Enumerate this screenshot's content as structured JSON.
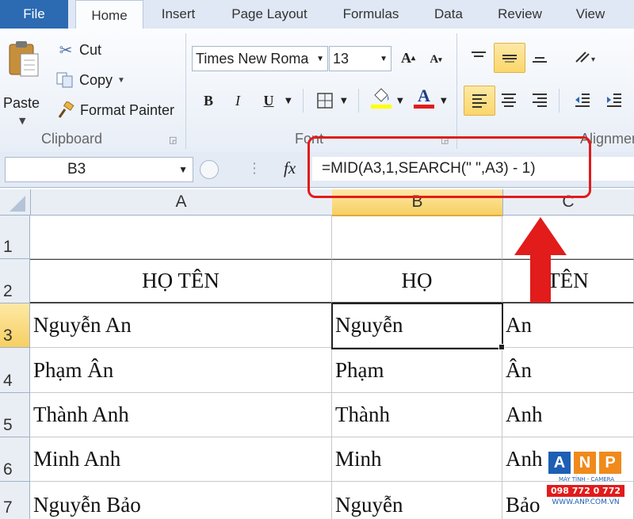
{
  "ribbon": {
    "tabs": [
      "File",
      "Home",
      "Insert",
      "Page Layout",
      "Formulas",
      "Data",
      "Review",
      "View"
    ],
    "clipboard": {
      "paste_label": "Paste",
      "cut_label": "Cut",
      "copy_label": "Copy",
      "format_painter_label": "Format Painter",
      "group_label": "Clipboard"
    },
    "font": {
      "font_name": "Times New Roma",
      "font_size": "13",
      "group_label": "Font"
    },
    "alignment": {
      "group_label": "Alignment"
    }
  },
  "formula_bar": {
    "name_box": "B3",
    "fx_label": "fx",
    "formula": "=MID(A3,1,SEARCH(\" \",A3) - 1)"
  },
  "grid": {
    "columns": [
      "A",
      "B",
      "C"
    ],
    "rows": [
      {
        "num": "1",
        "cells": [
          "",
          "",
          ""
        ]
      },
      {
        "num": "2",
        "cells": [
          "HỌ TÊN",
          "HỌ",
          "TÊN"
        ]
      },
      {
        "num": "3",
        "cells": [
          "Nguyễn An",
          "Nguyễn",
          "An"
        ]
      },
      {
        "num": "4",
        "cells": [
          "Phạm Ân",
          "Phạm",
          "Ân"
        ]
      },
      {
        "num": "5",
        "cells": [
          "Thành Anh",
          "Thành",
          "Anh"
        ]
      },
      {
        "num": "6",
        "cells": [
          "Minh Anh",
          "Minh",
          "Anh"
        ]
      },
      {
        "num": "7",
        "cells": [
          "Nguyễn Bảo",
          "Nguyễn",
          "Bảo"
        ]
      }
    ]
  },
  "watermark": {
    "letters": [
      "A",
      "N",
      "P"
    ],
    "tagline": "MÁY TÍNH - CAMERA",
    "phone": "098 772 0 772",
    "site": "WWW.ANP.COM.VN"
  },
  "colors": {
    "file_tab": "#2c6ab2",
    "highlight": "#fbd66a",
    "annotation_red": "#e21b1b"
  }
}
